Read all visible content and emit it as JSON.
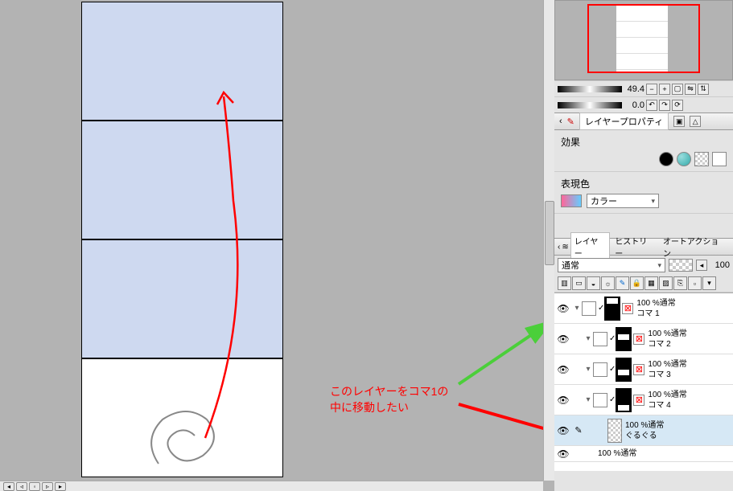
{
  "zoom": {
    "value": "49.4",
    "rotation": "0.0"
  },
  "panels": {
    "layer_property_tab": "レイヤープロパティ",
    "effect_label": "効果",
    "color_expression_label": "表現色",
    "color_mode": "カラー"
  },
  "layer_panel": {
    "tab_layer": "レイヤー",
    "tab_history": "ヒストリー",
    "tab_autoaction": "オートアクション",
    "blend_mode": "通常",
    "opacity": "100"
  },
  "layers": [
    {
      "opacity_label": "100 %通常",
      "name": "コマ 1",
      "folder": true
    },
    {
      "opacity_label": "100 %通常",
      "name": "コマ 2",
      "folder": true
    },
    {
      "opacity_label": "100 %通常",
      "name": "コマ 3",
      "folder": true
    },
    {
      "opacity_label": "100 %通常",
      "name": "コマ 4",
      "folder": true
    },
    {
      "opacity_label": "100 %通常",
      "name": "ぐるぐる",
      "folder": false
    },
    {
      "opacity_label": "100 %通常",
      "name": "",
      "folder": false
    }
  ],
  "annotation": {
    "line1": "このレイヤーをコマ1の",
    "line2": "中に移動したい"
  }
}
